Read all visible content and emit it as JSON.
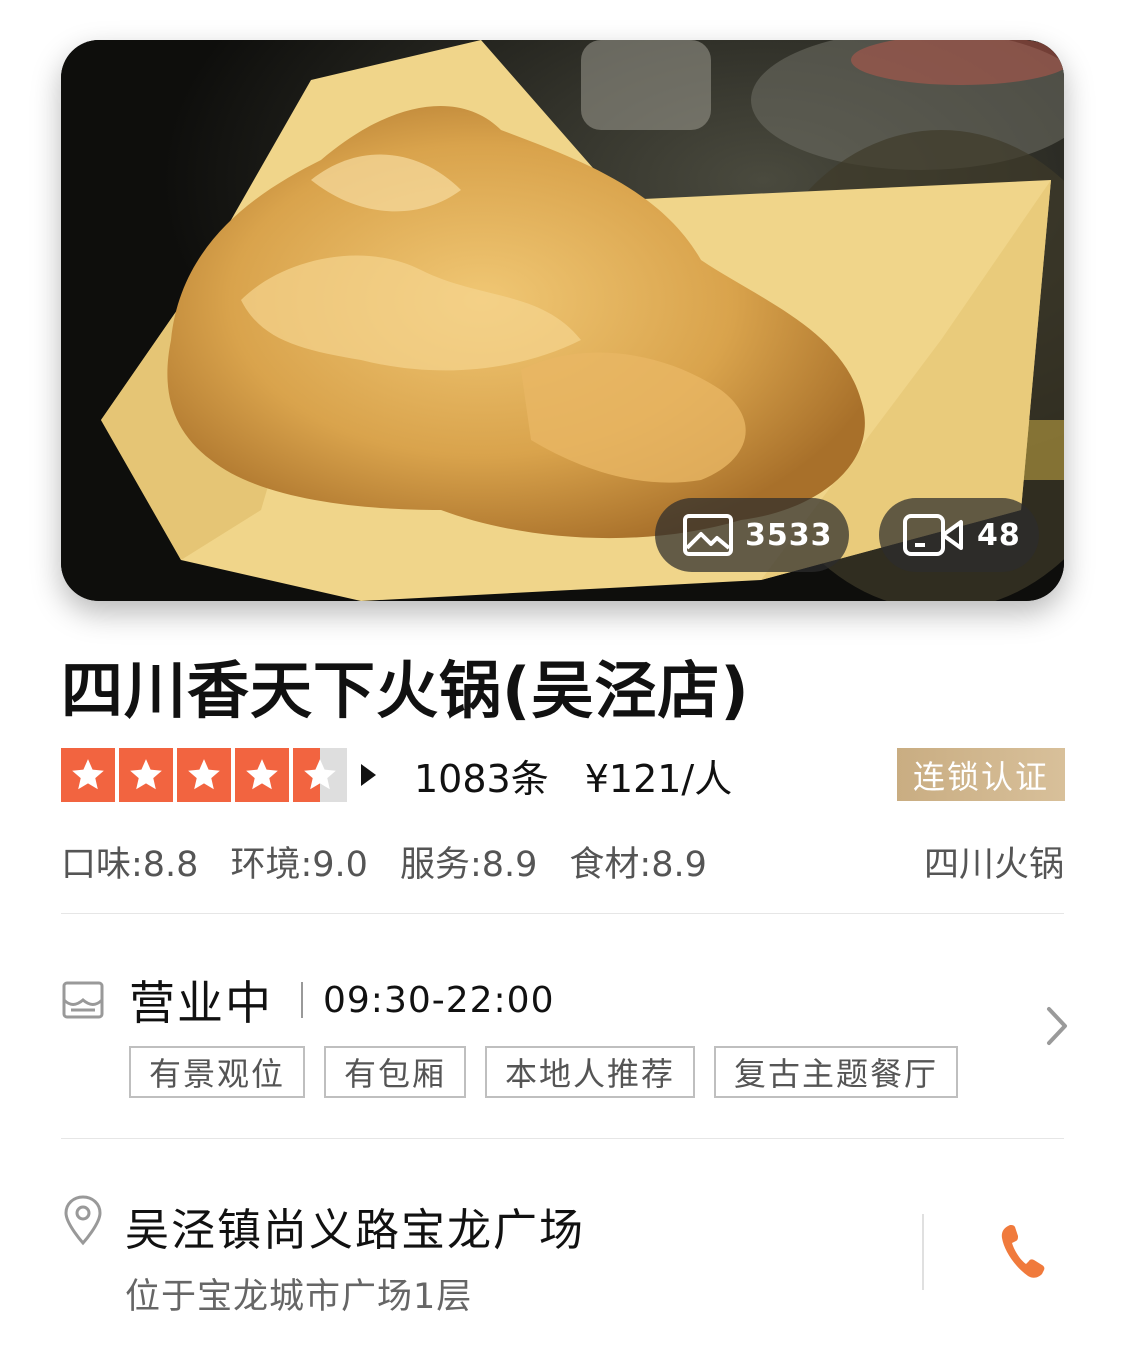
{
  "hero": {
    "photo_count": "3533",
    "video_count": "48",
    "photo_icon": "image-icon",
    "video_icon": "video-camera-icon"
  },
  "shop": {
    "name": "四川香天下火锅(吴泾店)",
    "rating": 4.5,
    "review_count": "1083条",
    "price_per_person": "¥121/人",
    "chain_badge": "连锁认证",
    "cuisine": "四川火锅",
    "scores": [
      {
        "label": "口味:8.8"
      },
      {
        "label": "环境:9.0"
      },
      {
        "label": "服务:8.9"
      },
      {
        "label": "食材:8.9"
      }
    ]
  },
  "hours": {
    "status": "营业中",
    "time": "09:30-22:00",
    "tags": [
      "有景观位",
      "有包厢",
      "本地人推荐",
      "复古主题餐厅"
    ]
  },
  "address": {
    "main": "吴泾镇尚义路宝龙广场",
    "sub": "位于宝龙城市广场1层"
  },
  "colors": {
    "star": "#f26440",
    "badge": "#cdb389",
    "phone": "#f07a3c"
  }
}
